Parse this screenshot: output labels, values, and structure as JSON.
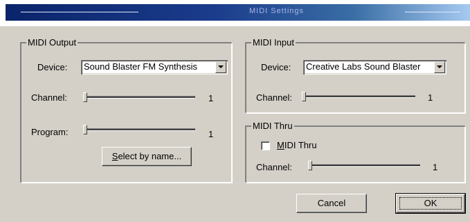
{
  "window": {
    "title": "MIDI Settings"
  },
  "midi_output": {
    "legend": "MIDI Output",
    "device_label": "Device:",
    "device_value": "Sound Blaster FM Synthesis",
    "channel_label": "Channel:",
    "channel_value": "1",
    "program_label": "Program:",
    "program_value": "1",
    "select_by_name_accel": "S",
    "select_by_name_rest": "elect by name..."
  },
  "midi_input": {
    "legend": "MIDI Input",
    "device_label": "Device:",
    "device_value": "Creative Labs Sound Blaster",
    "channel_label": "Channel:",
    "channel_value": "1"
  },
  "midi_thru": {
    "legend": "MIDI Thru",
    "checkbox_accel": "M",
    "checkbox_rest": "IDI Thru",
    "checked": false,
    "channel_label": "Channel:",
    "channel_value": "1"
  },
  "buttons": {
    "cancel": "Cancel",
    "ok": "OK"
  },
  "icons": {
    "combo_arrow": "chevron-down-icon"
  }
}
